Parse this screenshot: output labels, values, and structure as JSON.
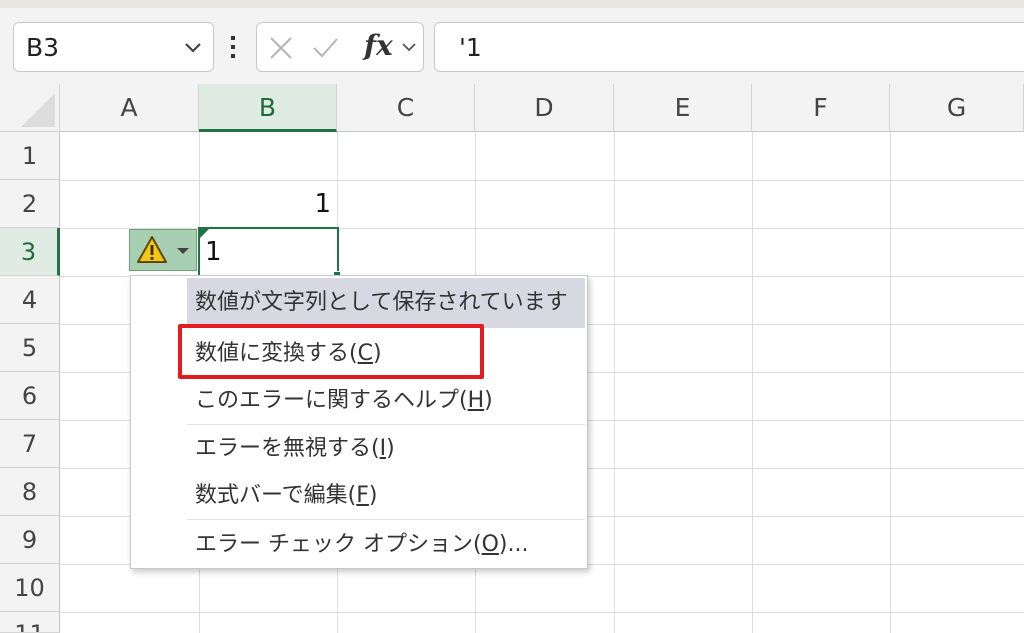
{
  "formula_bar": {
    "name_box": "B3",
    "formula_value": "'1",
    "fx_label": "fx"
  },
  "columns": [
    "A",
    "B",
    "C",
    "D",
    "E",
    "F",
    "G"
  ],
  "rows": [
    "1",
    "2",
    "3",
    "4",
    "5",
    "6",
    "7",
    "8",
    "9",
    "10",
    "11"
  ],
  "active_cell": {
    "column": "B",
    "row": "3"
  },
  "cells": {
    "B2": "1",
    "B3": "1"
  },
  "error_menu": {
    "header": "数値が文字列として保存されています",
    "items": [
      {
        "text": "数値に変換する(",
        "key": "C",
        "tail": ")"
      },
      {
        "text": "このエラーに関するヘルプ(",
        "key": "H",
        "tail": ")"
      },
      {
        "text": "エラーを無視する(",
        "key": "I",
        "tail": ")"
      },
      {
        "text": "数式バーで編集(",
        "key": "F",
        "tail": ")"
      },
      {
        "text": "エラー チェック オプション(",
        "key": "O",
        "tail": ")..."
      }
    ]
  },
  "colors": {
    "accent_green": "#217346",
    "highlight_red": "#e11d21",
    "menu_header_bg": "#d8d8e3",
    "warning_yellow": "#f5c518"
  },
  "icons": [
    "chevron-down-icon",
    "more-vertical-icon",
    "cancel-x-icon",
    "check-icon",
    "warning-icon",
    "dropdown-caret-icon"
  ]
}
